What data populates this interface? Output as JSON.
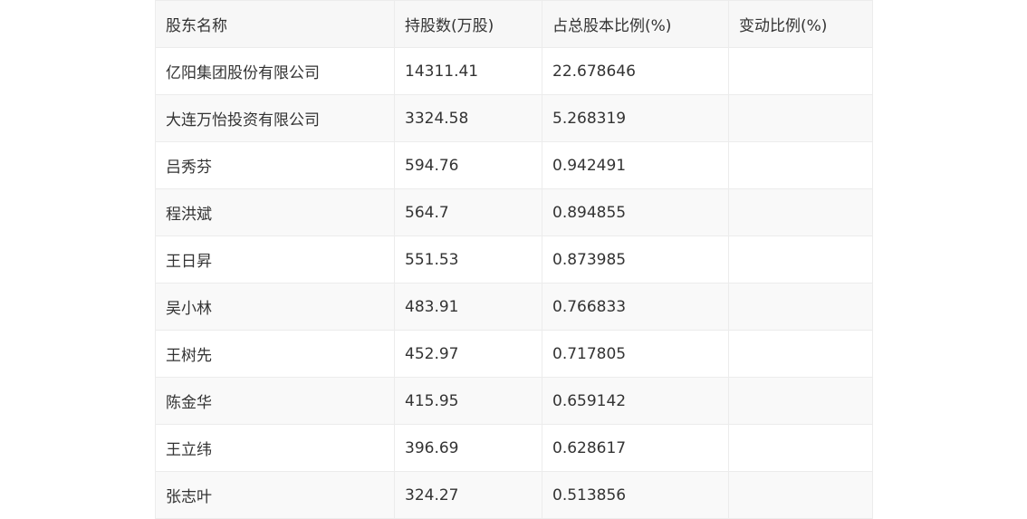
{
  "table": {
    "headers": [
      "股东名称",
      "持股数(万股)",
      "占总股本比例(%)",
      "变动比例(%)"
    ],
    "rows": [
      [
        "亿阳集团股份有限公司",
        "14311.41",
        "22.678646",
        ""
      ],
      [
        "大连万怡投资有限公司",
        "3324.58",
        "5.268319",
        ""
      ],
      [
        "吕秀芬",
        "594.76",
        "0.942491",
        ""
      ],
      [
        "程洪斌",
        "564.7",
        "0.894855",
        ""
      ],
      [
        "王日昇",
        "551.53",
        "0.873985",
        ""
      ],
      [
        "吴小林",
        "483.91",
        "0.766833",
        ""
      ],
      [
        "王树先",
        "452.97",
        "0.717805",
        ""
      ],
      [
        "陈金华",
        "415.95",
        "0.659142",
        ""
      ],
      [
        "王立纬",
        "396.69",
        "0.628617",
        ""
      ],
      [
        "张志叶",
        "324.27",
        "0.513856",
        ""
      ]
    ]
  }
}
